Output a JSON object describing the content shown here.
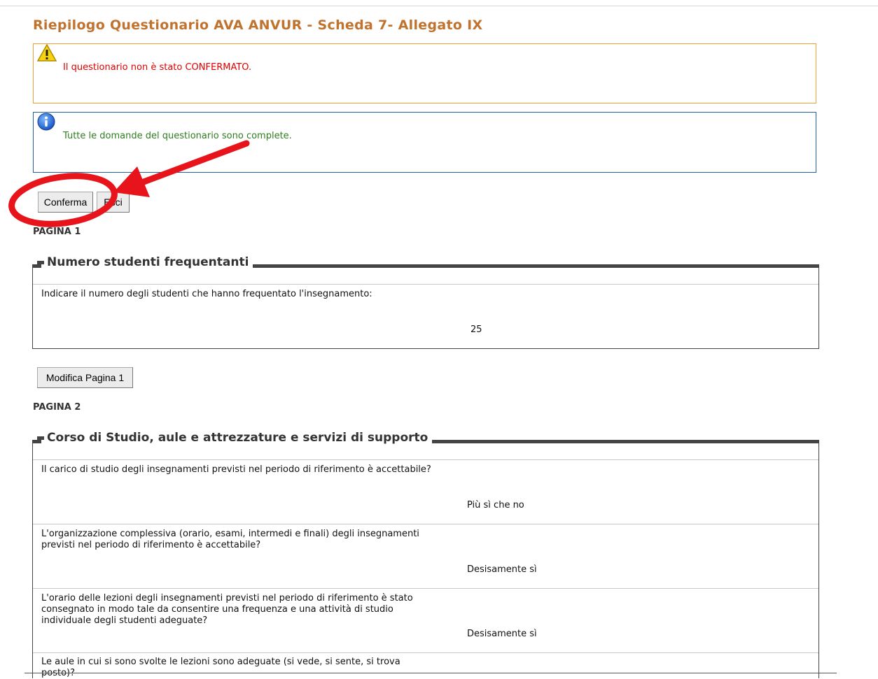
{
  "page_title": "Riepilogo Questionario AVA ANVUR - Scheda 7- Allegato IX",
  "warning": {
    "icon": "warning-icon",
    "text_before": "Il questionario non è stato ",
    "text_emphasis": "CONFERMATO."
  },
  "info": {
    "icon": "info-icon",
    "text": "Tutte le domande del questionario sono complete."
  },
  "buttons": {
    "confirm": "Conferma",
    "exit": "Esci",
    "edit_page_1": "Modifica Pagina 1"
  },
  "pages": [
    {
      "label": "PAGINA 1",
      "section_title": "Numero studenti frequentanti",
      "questions": [
        {
          "question": "Indicare il numero degli studenti che hanno frequentato l'insegnamento:",
          "answer": "25"
        }
      ]
    },
    {
      "label": "PAGINA 2",
      "section_title": "Corso di Studio, aule e attrezzature e servizi di supporto",
      "questions": [
        {
          "question": "Il carico di studio degli insegnamenti previsti nel periodo di riferimento è accettabile?",
          "answer": "Più sì che no"
        },
        {
          "question": "L'organizzazione complessiva (orario, esami, intermedi e finali) degli insegnamenti previsti nel periodo di riferimento è accettabile?",
          "answer": "Desisamente sì"
        },
        {
          "question": "L'orario delle lezioni degli insegnamenti previsti nel periodo di riferimento è stato consegnato in modo tale da consentire una frequenza e una attività di studio individuale degli studenti adeguate?",
          "answer": "Desisamente sì"
        },
        {
          "question": "Le aule in cui si sono svolte le lezioni sono adeguate (si vede, si sente, si trova posto)?",
          "answer": ""
        }
      ]
    }
  ],
  "annotation": {
    "color": "#e8141c"
  }
}
